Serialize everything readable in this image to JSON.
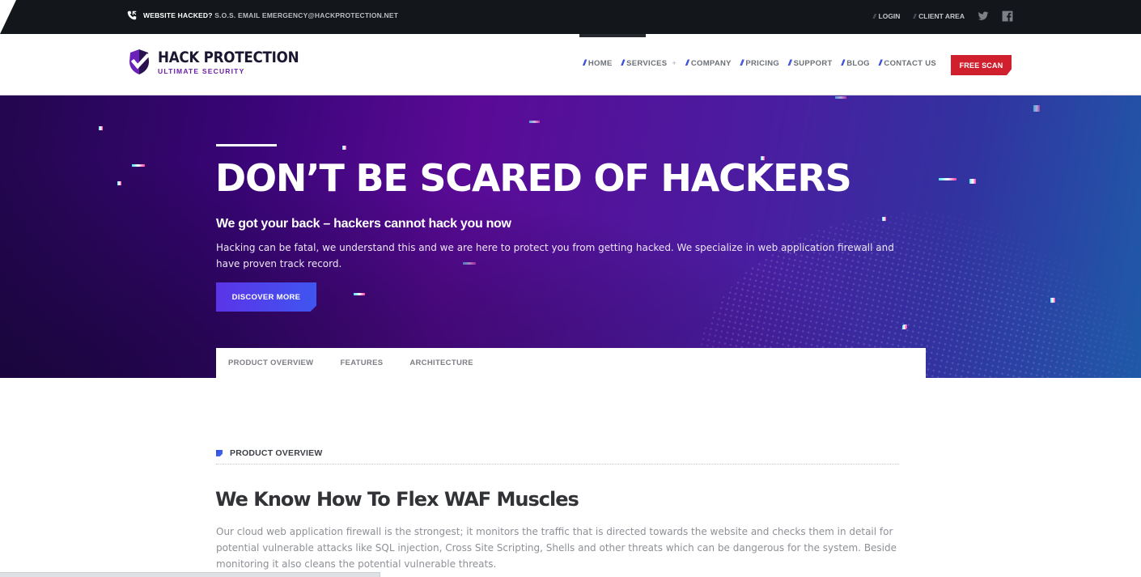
{
  "topbar": {
    "alert_strong": "WEBSITE HACKED?",
    "alert_text": "S.O.S. EMAIL EMERGENCY@HACKPROTECTION.NET",
    "login": "LOGIN",
    "client_area": "CLIENT AREA",
    "slash": "//",
    "icons": {
      "phone": "phone-icon",
      "twitter": "twitter-icon",
      "facebook": "facebook-icon"
    }
  },
  "header": {
    "logo_name": "HACK PROTECTION",
    "logo_tagline": "ULTIMATE SECURITY",
    "nav_slash": "//",
    "nav": [
      {
        "label": "HOME"
      },
      {
        "label": "SERVICES",
        "suffix": "+"
      },
      {
        "label": "COMPANY"
      },
      {
        "label": "PRICING"
      },
      {
        "label": "SUPPORT"
      },
      {
        "label": "BLOG"
      },
      {
        "label": "CONTACT US"
      }
    ],
    "cta": "FREE SCAN"
  },
  "hero": {
    "title": "DON’T BE SCARED OF HACKERS",
    "subtitle": "We got your back – hackers cannot hack you now",
    "description": "Hacking can be fatal, we understand this and we are here to protect you from getting hacked. We specialize in web application firewall and have proven track record.",
    "button": "DISCOVER MORE",
    "tabs": [
      "PRODUCT OVERVIEW",
      "FEATURES",
      "ARCHITECTURE"
    ]
  },
  "content": {
    "section_label": "PRODUCT OVERVIEW",
    "title": "We Know How To Flex WAF Muscles",
    "body": "Our cloud web application firewall is the strongest; it monitors the traffic that is directed towards the website and checks them in detail for potential vulnerable attacks like SQL injection, Cross Site Scripting, Shells and other threats which can be dangerous for the system. Beside monitoring it also cleans the potential vulnerable threats."
  },
  "colors": {
    "topbar_bg": "#13171b",
    "brand_purple": "#6b1fa8",
    "nav_accent": "#2a3fd8",
    "cta_red": "#d0202e",
    "button_blue": "#4a45ec"
  }
}
